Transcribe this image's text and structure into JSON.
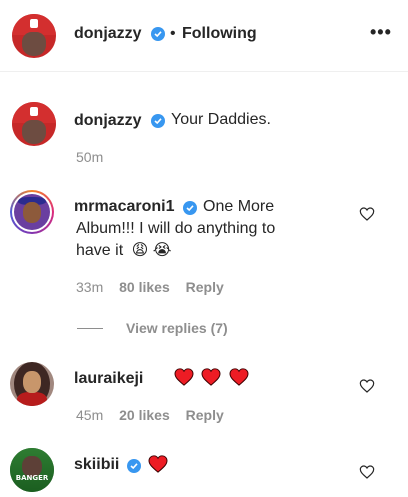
{
  "header": {
    "username": "donjazzy",
    "separator": "•",
    "follow_status": "Following",
    "more_icon": "more-horizontal-icon",
    "more_label": "•••"
  },
  "caption": {
    "username": "donjazzy",
    "text": "Your Daddies.",
    "time": "50m"
  },
  "comments": [
    {
      "username": "mrmacaroni1",
      "verified": true,
      "text_line1": "One More",
      "text_line2": "Album!!! I will do anything to",
      "text_line3": "have it",
      "emojis": [
        "😩",
        "😭"
      ],
      "time": "33m",
      "likes": "80 likes",
      "reply": "Reply",
      "view_replies": "View replies (7)"
    },
    {
      "username": "lauraikeji",
      "verified": false,
      "hearts": 3,
      "time": "45m",
      "likes": "20 likes",
      "reply": "Reply"
    },
    {
      "username": "skiibii",
      "verified": true,
      "hearts": 1
    }
  ],
  "colors": {
    "verified": "#3897f0",
    "secondary_text": "#8e8e8e",
    "heart_red": "#ed1c24"
  }
}
